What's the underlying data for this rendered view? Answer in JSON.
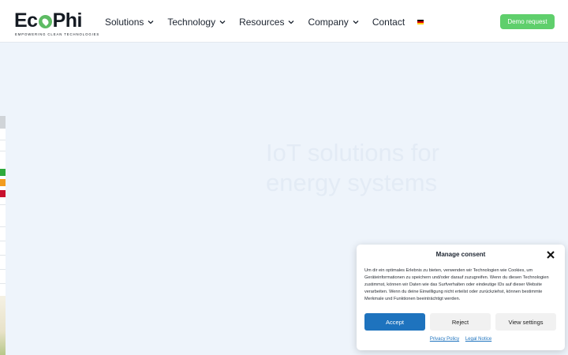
{
  "header": {
    "logo": {
      "wordmark_pre": "Ec",
      "wordmark_post": "Phi",
      "tagline": "EMPOWERING CLEAN TECHNOLOGIES"
    },
    "nav": [
      {
        "label": "Solutions",
        "has_dropdown": true
      },
      {
        "label": "Technology",
        "has_dropdown": true
      },
      {
        "label": "Resources",
        "has_dropdown": true
      },
      {
        "label": "Company",
        "has_dropdown": true
      },
      {
        "label": "Contact",
        "has_dropdown": false
      }
    ],
    "language_flag": "de-flag-icon",
    "demo_button": "Demo request"
  },
  "hero": {
    "title": "IoT solutions for energy systems"
  },
  "consent": {
    "title": "Manage consent",
    "text": "Um dir ein optimales Erlebnis zu bieten, verwenden wir Technologien wie Cookies, um Geräteinformationen zu speichern und/oder darauf zuzugreifen. Wenn du diesen Technologien zustimmst, können wir Daten wie das Surfverhalten oder eindeutige IDs auf dieser Website verarbeiten. Wenn du deine Einwilligung nicht erteilst oder zurückziehst, können bestimmte Merkmale und Funktionen beeinträchtigt werden.",
    "accept": "Accept",
    "reject": "Reject",
    "view": "View settings",
    "privacy": "Privacy Policy",
    "legal": "Legal Notice"
  },
  "colors": {
    "brand_green": "#5fcf6c",
    "accept_blue": "#1e73be",
    "hero_bg": "#eef4fb"
  }
}
